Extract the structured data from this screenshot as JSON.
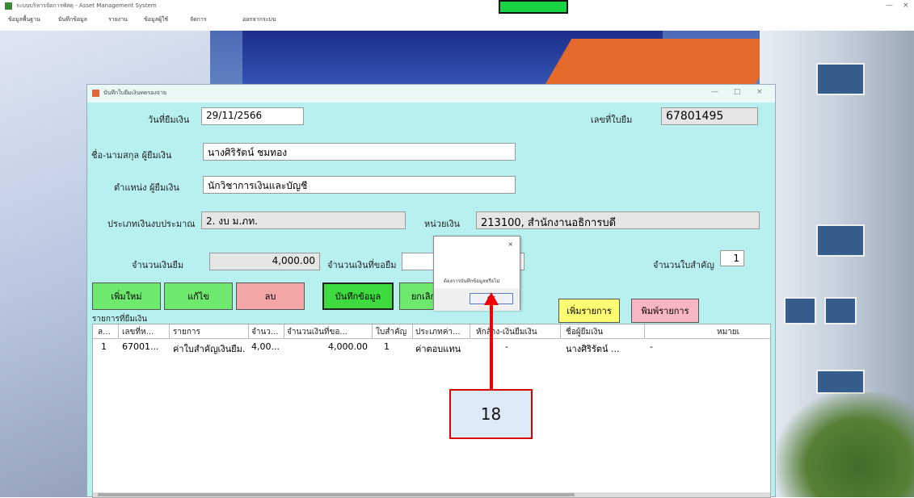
{
  "app": {
    "title": "ระบบบริหารจัดการพัสดุ - Asset Management System",
    "menu": [
      "ข้อมูลพื้นฐาน",
      "บันทึกข้อมูล",
      "รายงาน",
      "ข้อมูลผู้ใช้",
      "จัดการ",
      "ออกจากระบบ"
    ],
    "window_controls": {
      "minimize": "—",
      "close": "×"
    }
  },
  "dialog": {
    "title": "บันทึกใบยืมเงินทดรองจ่าย",
    "window_controls": {
      "minimize": "—",
      "maximize": "□",
      "close": "×"
    },
    "fields": {
      "borrow_date_label": "วันที่ยืมเงิน",
      "borrow_date": "29/11/2566",
      "doc_no_label": "เลขที่ใบยืม",
      "doc_no": "67801495",
      "borrower_name_label": "ชื่อ-นามสกุล ผู้ยืมเงิน",
      "borrower_name": "นางศิริรัตน์ ชมทอง",
      "borrower_dept_label": "ตำแหน่ง ผู้ยืมเงิน",
      "borrower_dept": "นักวิชาการเงินและบัญชี",
      "budget_type_label": "ประเภทเงินงบประมาณ",
      "budget_type": "2. งบ ม.ภท.",
      "unit_label": "หน่วยเงิน",
      "unit": "213100, สำนักงานอธิการบดี",
      "amount_label": "จำนวนเงินยืม",
      "amount": "4,000.00",
      "total_label": "จำนวนเงินที่ขอยืม",
      "total_value": "0",
      "doc_count_label": "จำนวนใบสำคัญ",
      "doc_count": "1"
    },
    "buttons": {
      "new": "เพิ่มใหม่",
      "edit": "แก้ไข",
      "delete": "ลบ",
      "save": "บันทึกข้อมูล",
      "cancel": "ยกเลิก",
      "add_item": "เพิ่มรายการ",
      "print_item": "พิมพ์รายการ"
    },
    "list_title": "รายการที่ยืมเงิน",
    "grid": {
      "headers": [
        "ล...",
        "เลขที่ห...",
        "รายการ",
        "จำนว...",
        "จำนวนเงินที่ขอ...",
        "ใบสำคัญ",
        "ประเภทค่า...",
        "หักล้าง-เงินยืมเงิน",
        "ชื่อผู้ยืมเงิน",
        "หมายเ"
      ],
      "rows": [
        [
          "1",
          "67001...",
          "ค่าใบสำคัญเงินยืม...",
          "4,00...",
          "4,000.00",
          "1",
          "ค่าตอบแทน",
          "-",
          "นางศิริรัตน์ ...",
          "-"
        ]
      ]
    },
    "message_box": {
      "close": "×",
      "text": "ต้องการบันทึกข้อมูลหรือไม่",
      "ok": "OK"
    }
  },
  "callout": {
    "number": "18",
    "color": "#d80000"
  }
}
